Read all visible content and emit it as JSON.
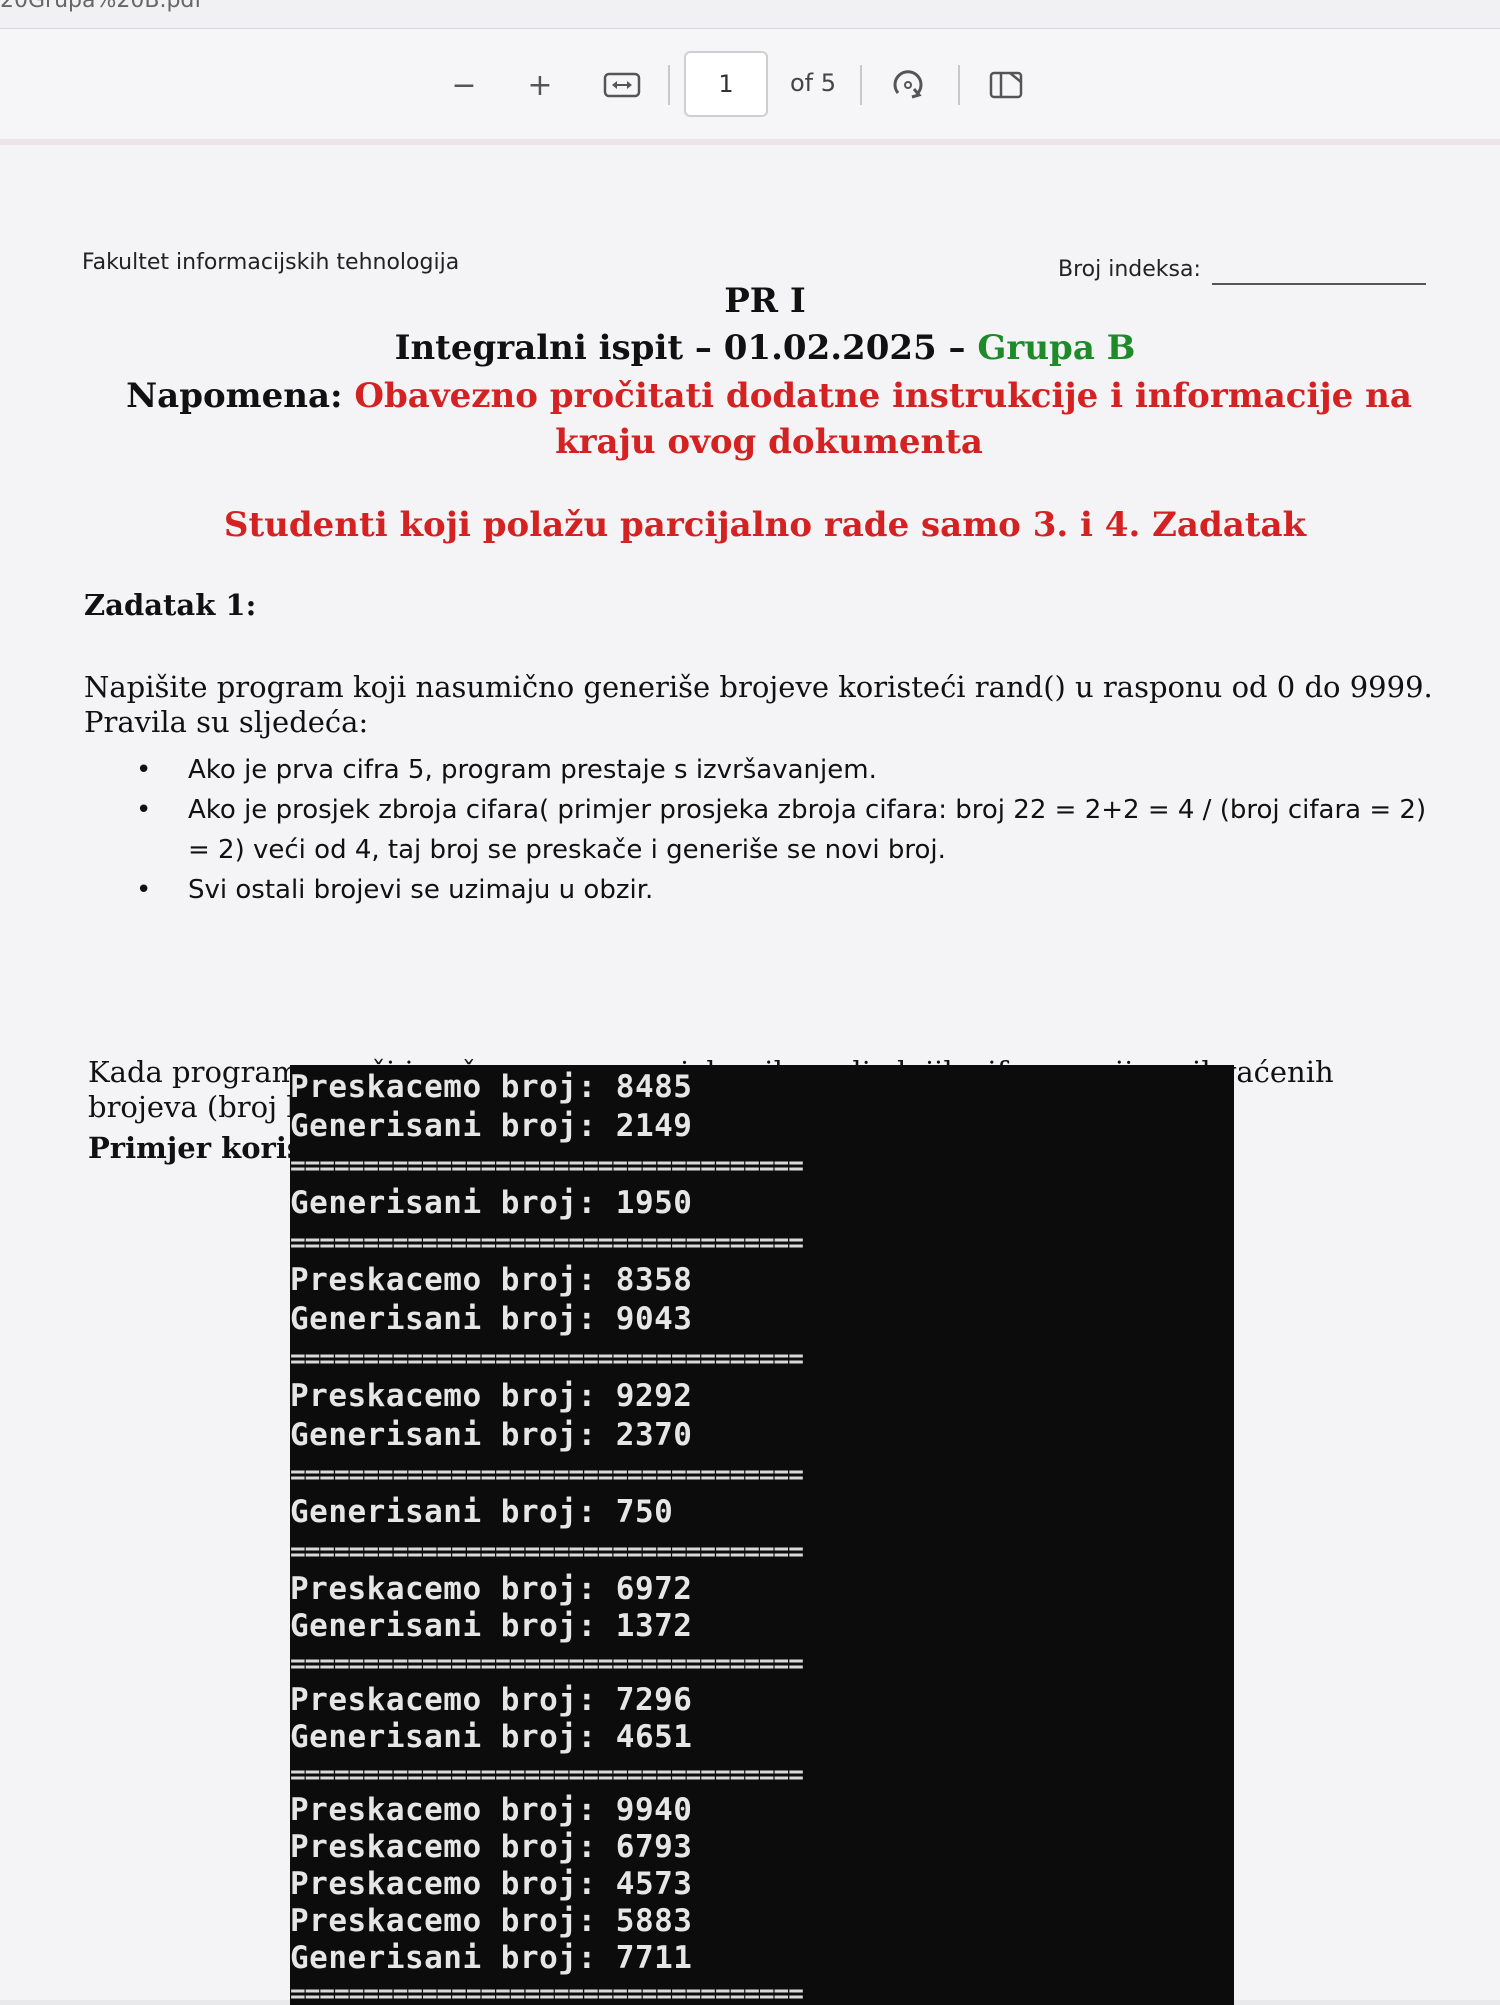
{
  "viewer": {
    "filename": "20Grupa%20B.pdf",
    "zoom_out": "−",
    "zoom_in": "+",
    "page_number": "1",
    "page_total": "of 5"
  },
  "doc": {
    "faculty": "Fakultet informacijskih tehnologija",
    "index_label": "Broj indeksa:",
    "course": "PR I",
    "exam_title": "Integralni ispit – 01.02.2025 – ",
    "group": "Grupa B",
    "note_label": "Napomena: ",
    "note_text": "Obavezno pročitati dodatne instrukcije i informacije na kraju ovog dokumenta",
    "partial_note": "Studenti koji polažu parcijalno rade samo 3. i 4. Zadatak",
    "task_heading": "Zadatak 1:",
    "task_intro": "Napišite program koji nasumično generiše brojeve koristeći rand() u rasponu od 0 do 9999. Pravila su sljedeća:",
    "rules": [
      "Ako je prva cifra 5, program prestaje s izvršavanjem.",
      "Ako je prosjek zbroja cifara( primjer prosjeka zbroja cifara: broj 22 = 2+2 = 4 / (broj cifara = 2) = 2) veći od 4, taj broj se preskače i generiše se novi broj.",
      "Svi ostali brojevi se uzimaju u obzir."
    ],
    "task_outro": "Kada program završi izračunava se prosjek svih posljednjih cifara ranije prihvaćenih brojeva (broj koji završava program ne uzima se u obzir).",
    "example_heading": "Primjer korištenja:"
  },
  "console": {
    "lines": [
      "Preskacemo broj: 8485",
      "Generisani broj: 2149",
      "===================================",
      "Generisani broj: 1950",
      "===================================",
      "Preskacemo broj: 8358",
      "Generisani broj: 9043",
      "===================================",
      "Preskacemo broj: 9292",
      "Generisani broj: 2370",
      "===================================",
      "Generisani broj: 750",
      "===================================",
      "Preskacemo broj: 6972",
      "Generisani broj: 1372",
      "===================================",
      "Preskacemo broj: 7296",
      "Generisani broj: 4651",
      "===================================",
      "Preskacemo broj: 9940",
      "Preskacemo broj: 6793",
      "Preskacemo broj: 4573",
      "Preskacemo broj: 5883",
      "Generisani broj: 7711",
      "==================================="
    ]
  }
}
